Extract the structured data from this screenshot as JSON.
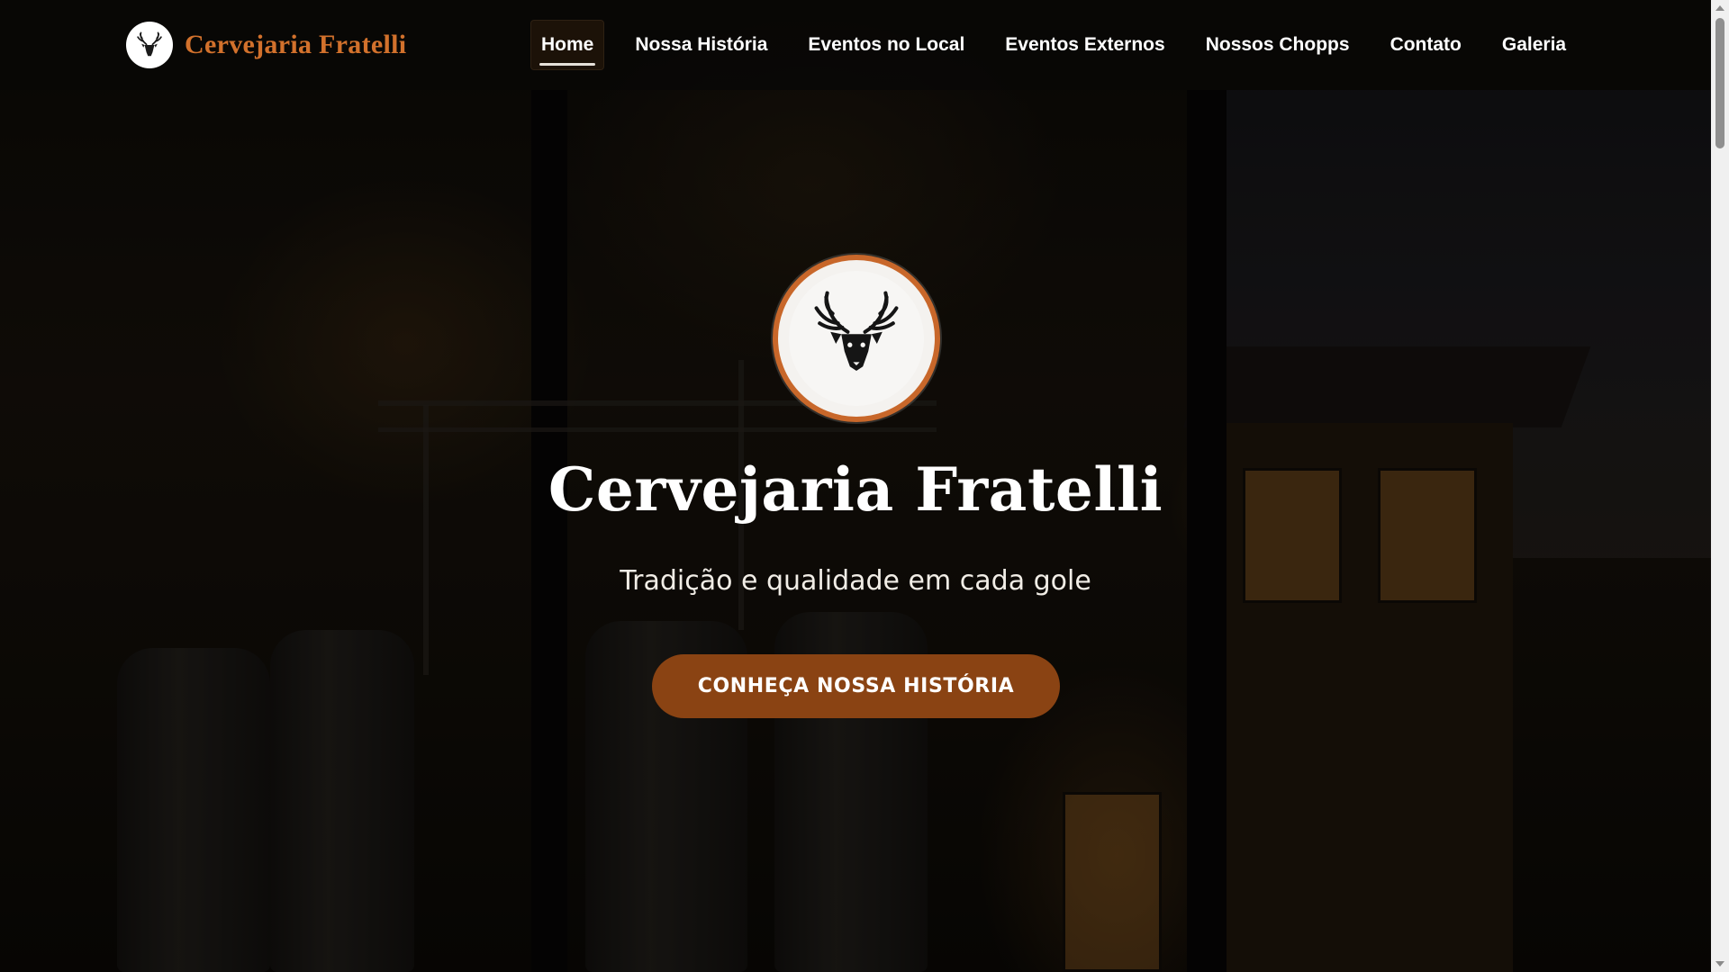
{
  "brand": {
    "name": "Cervejaria Fratelli",
    "logo_icon": "deer-head-icon"
  },
  "nav": {
    "items": [
      {
        "label": "Home",
        "active": true
      },
      {
        "label": "Nossa História",
        "active": false
      },
      {
        "label": "Eventos no Local",
        "active": false
      },
      {
        "label": "Eventos Externos",
        "active": false
      },
      {
        "label": "Nossos Chopps",
        "active": false
      },
      {
        "label": "Contato",
        "active": false
      },
      {
        "label": "Galeria",
        "active": false
      }
    ]
  },
  "hero": {
    "logo_icon": "deer-head-icon",
    "title": "Cervejaria Fratelli",
    "subtitle": "Tradição e qualidade em cada gole",
    "cta_label": "CONHEÇA NOSSA HISTÓRIA"
  },
  "colors": {
    "brand_orange": "#d2712c",
    "cta_brown": "#8a4313",
    "logo_ring": "#c8672a"
  }
}
